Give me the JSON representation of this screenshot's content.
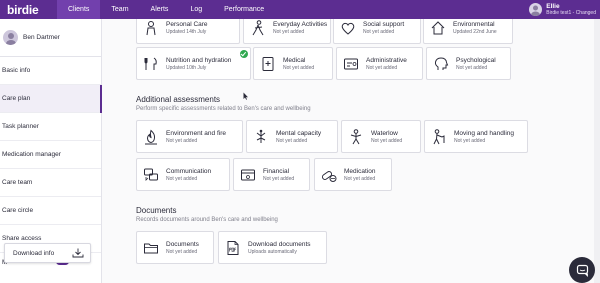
{
  "brand": {
    "logo": "birdie",
    "accent": "#5c2d91"
  },
  "nav": {
    "items": [
      "Clients",
      "Team",
      "Alerts",
      "Log",
      "Performance"
    ],
    "active": "Clients"
  },
  "user": {
    "name": "Ellie",
    "subtitle": "Birdie test1 - Changed"
  },
  "sidebar": {
    "client_name": "Ben Dartmer",
    "items": [
      "Basic info",
      "Care plan",
      "Task planner",
      "Medication manager",
      "Care team",
      "Care circle",
      "Share access"
    ],
    "active": "Care plan",
    "partial_item": "M",
    "download_label": "Download info"
  },
  "care_plan_cards": [
    {
      "title": "Personal Care",
      "status": "Updated 14th July",
      "icon": "personal-care-icon"
    },
    {
      "title": "Everyday Activities",
      "status": "Not yet added",
      "icon": "everyday-activities-icon"
    },
    {
      "title": "Social support",
      "status": "Not yet added",
      "icon": "social-support-icon"
    },
    {
      "title": "Environmental",
      "status": "Updated 22nd June",
      "icon": "environmental-icon"
    },
    {
      "title": "Nutrition and hydration",
      "status": "Updated 10th July",
      "icon": "nutrition-icon",
      "completed": true
    },
    {
      "title": "Medical",
      "status": "Not yet added",
      "icon": "medical-icon"
    },
    {
      "title": "Administrative",
      "status": "Not yet added",
      "icon": "administrative-icon"
    },
    {
      "title": "Psychological",
      "status": "Not yet added",
      "icon": "psychological-icon"
    }
  ],
  "additional": {
    "title": "Additional assessments",
    "subtitle": "Perform specific assessments related to Ben's care and wellbeing",
    "cards": [
      {
        "title": "Environment and fire",
        "status": "Not yet added",
        "icon": "environment-fire-icon"
      },
      {
        "title": "Mental capacity",
        "status": "Not yet added",
        "icon": "mental-capacity-icon"
      },
      {
        "title": "Waterlow",
        "status": "Not yet added",
        "icon": "waterlow-icon"
      },
      {
        "title": "Moving and handling",
        "status": "Not yet added",
        "icon": "moving-handling-icon"
      },
      {
        "title": "Communication",
        "status": "Not yet added",
        "icon": "communication-icon"
      },
      {
        "title": "Financial",
        "status": "Not yet added",
        "icon": "financial-icon"
      },
      {
        "title": "Medication",
        "status": "Not yet added",
        "icon": "medication-icon"
      }
    ]
  },
  "documents": {
    "title": "Documents",
    "subtitle": "Records documents around Ben's care and wellbeing",
    "cards": [
      {
        "title": "Documents",
        "status": "Not yet added",
        "icon": "folder-icon"
      },
      {
        "title": "Download documents",
        "status": "Uploads automatically",
        "icon": "pdf-icon"
      }
    ]
  },
  "chat_button": {
    "icon": "chat-icon"
  }
}
